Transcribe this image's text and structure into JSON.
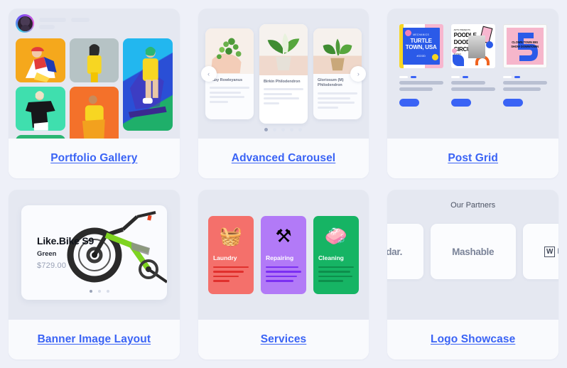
{
  "cards": [
    {
      "id": "portfolio-gallery",
      "title": "Portfolio Gallery"
    },
    {
      "id": "advanced-carousel",
      "title": "Advanced Carousel"
    },
    {
      "id": "post-grid",
      "title": "Post Grid"
    },
    {
      "id": "banner-image-layout",
      "title": "Banner Image Layout"
    },
    {
      "id": "services",
      "title": "Services"
    },
    {
      "id": "logo-showcase",
      "title": "Logo Showcase"
    }
  ],
  "portfolio": {
    "tiles": [
      {
        "name": "tile-yellow",
        "color": "#f5a81c"
      },
      {
        "name": "tile-gray",
        "color": "#b6c3c5"
      },
      {
        "name": "tile-blue",
        "color": "#1f7fe0"
      },
      {
        "name": "tile-teal",
        "color": "#3fdfae"
      },
      {
        "name": "tile-orange",
        "color": "#f4712a"
      },
      {
        "name": "tile-green",
        "color": "#2bb673"
      }
    ]
  },
  "carousel": {
    "items": [
      {
        "title": "Baby Rowleyanus"
      },
      {
        "title": "Birkin Philodendron"
      },
      {
        "title": "Gloriosum (M) Philodendron"
      }
    ],
    "prev_icon": "‹",
    "next_icon": "›",
    "dots": 5,
    "active_dot": 0
  },
  "post_grid": {
    "posts": [
      {
        "title": "TURTLE TOWN, USA",
        "kicker": "MECHANICS",
        "footer": "#GOOD",
        "bg": "#2b5ae8"
      },
      {
        "title": "POODLE DOODLE CIRCUS",
        "kicker": "ARTS PRESENTS",
        "footer": "#OPEN",
        "bg": "#ffffff"
      },
      {
        "title": "CLOWN TOWN BIG SHOW DOWNTOWN",
        "kicker": "",
        "footer": "",
        "bg": "#f6b6cb"
      }
    ]
  },
  "banner": {
    "product_title": "Like.Bike S9",
    "variant": "Green",
    "price": "$729.00",
    "dots": 3,
    "active_dot": 0
  },
  "services": {
    "items": [
      {
        "label": "Laundry",
        "bg": "#f4706b",
        "line": "#e0302d",
        "icon": "🧺"
      },
      {
        "label": "Repairing",
        "bg": "#b27af7",
        "line": "#7b2ff2",
        "icon": "⚒"
      },
      {
        "label": "Cleaning",
        "bg": "#16b464",
        "line": "#0d8f4c",
        "icon": "🧼"
      }
    ]
  },
  "logo_showcase": {
    "heading": "Our Partners",
    "logos": [
      {
        "text": "dar."
      },
      {
        "text": "Mashable"
      },
      {
        "text": "W",
        "suffix": "I"
      }
    ]
  },
  "colors": {
    "page_bg": "#eef0f8",
    "card_bg": "#f7f9fd",
    "preview_bg": "#e5e8f1",
    "link": "#3a63f5",
    "accent_blue": "#3a63f5"
  }
}
